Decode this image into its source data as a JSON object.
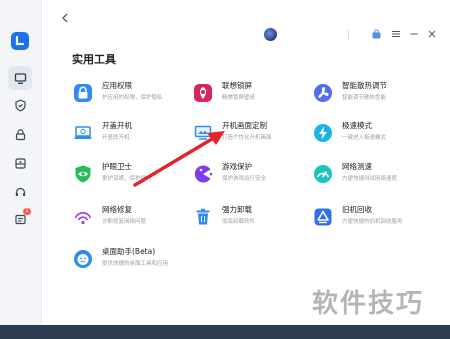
{
  "header": {
    "section_title": "实用工具"
  },
  "sidebar": {
    "items": [
      {
        "icon": "monitor-icon",
        "active": true
      },
      {
        "icon": "shield-icon",
        "active": false
      },
      {
        "icon": "lock-icon",
        "active": false
      },
      {
        "icon": "toolbox-icon",
        "active": false
      },
      {
        "icon": "headset-icon",
        "active": false
      },
      {
        "icon": "message-icon",
        "active": false,
        "badge": "1"
      }
    ],
    "badge": "1"
  },
  "tools": [
    {
      "name": "应用权限",
      "desc": "护应用的权限，保护隐私",
      "icon": "app-lock-icon"
    },
    {
      "name": "联想锁屏",
      "desc": "精美锁屏壁纸",
      "icon": "lenovo-lockscreen-icon"
    },
    {
      "name": "智能散热调节",
      "desc": "智能调节散热性能",
      "icon": "fan-icon"
    },
    {
      "name": "开盖开机",
      "desc": "开盖即开机",
      "icon": "laptop-power-icon"
    },
    {
      "name": "开机画面定制",
      "desc": "打造个性化开机画面",
      "icon": "boot-screen-icon"
    },
    {
      "name": "极速模式",
      "desc": "一键进入极速模式",
      "icon": "lightning-icon"
    },
    {
      "name": "护眼卫士",
      "desc": "爱护双眼，保护视力",
      "icon": "eye-shield-icon"
    },
    {
      "name": "游戏保护",
      "desc": "保护游戏运行安全",
      "icon": "game-icon"
    },
    {
      "name": "网络测速",
      "desc": "方便快捷测试网络速度",
      "icon": "speedometer-icon"
    },
    {
      "name": "网络修复",
      "desc": "诊断修复网络问题",
      "icon": "wifi-repair-icon"
    },
    {
      "name": "强力卸载",
      "desc": "彻底卸载软件",
      "icon": "trash-icon"
    },
    {
      "name": "旧机回收",
      "desc": "方便快捷的旧机回收服务",
      "icon": "recycle-icon"
    },
    {
      "name": "桌面助手(Beta)",
      "desc": "提供快捷的桌面工具和应用",
      "icon": "desktop-assistant-icon"
    }
  ],
  "watermark": "软件技巧",
  "colors": {
    "accent": "#1a73e8",
    "arrow": "#e0242a"
  }
}
